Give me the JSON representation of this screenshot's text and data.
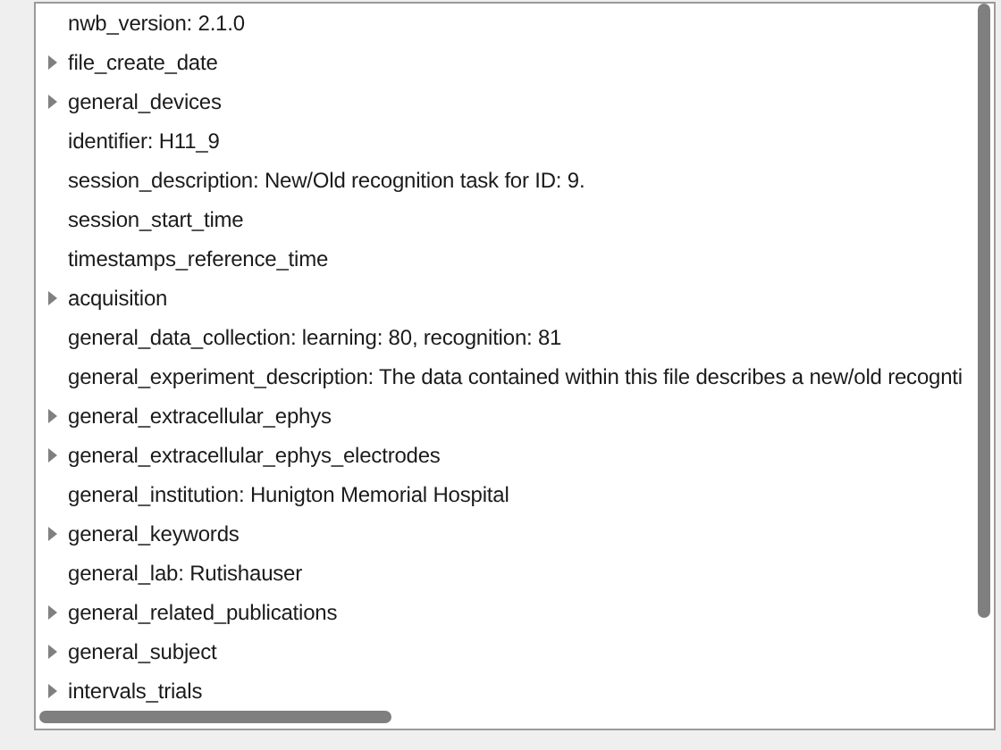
{
  "tree": {
    "items": [
      {
        "label": "nwb_version: 2.1.0",
        "expandable": false
      },
      {
        "label": "file_create_date",
        "expandable": true
      },
      {
        "label": "general_devices",
        "expandable": true
      },
      {
        "label": "identifier: H11_9",
        "expandable": false
      },
      {
        "label": "session_description: New/Old recognition task for ID: 9.",
        "expandable": false
      },
      {
        "label": "session_start_time",
        "expandable": false
      },
      {
        "label": "timestamps_reference_time",
        "expandable": false
      },
      {
        "label": "acquisition",
        "expandable": true
      },
      {
        "label": "general_data_collection: learning: 80, recognition: 81",
        "expandable": false
      },
      {
        "label": "general_experiment_description: The data contained within this file describes a new/old recognti",
        "expandable": false
      },
      {
        "label": "general_extracellular_ephys",
        "expandable": true
      },
      {
        "label": "general_extracellular_ephys_electrodes",
        "expandable": true
      },
      {
        "label": "general_institution: Hunigton Memorial Hospital",
        "expandable": false
      },
      {
        "label": "general_keywords",
        "expandable": true
      },
      {
        "label": "general_lab: Rutishauser",
        "expandable": false
      },
      {
        "label": "general_related_publications",
        "expandable": true
      },
      {
        "label": "general_subject",
        "expandable": true
      },
      {
        "label": "intervals_trials",
        "expandable": true
      }
    ]
  }
}
